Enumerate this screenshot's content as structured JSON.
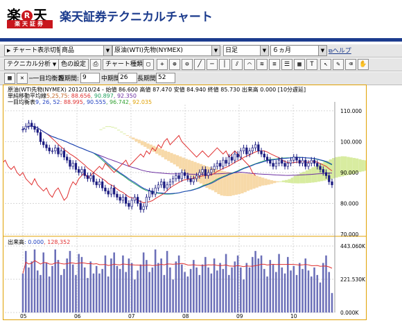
{
  "header": {
    "logo_text": [
      "楽",
      "R",
      "天"
    ],
    "logo_sub": "楽天証券",
    "title": "楽天証券テクニカルチャート"
  },
  "toolbar1": {
    "chart_switch": "チャート表示切替",
    "category": "商品",
    "instrument": "原油(WTI)先物(NYMEX)",
    "interval": "日足",
    "period": "６ヵ月",
    "help": "ヘルプ"
  },
  "toolbar2": {
    "tech_analysis": "テクニカル分析",
    "color_settings": "色の設定",
    "chart_type": "チャート種類",
    "tool_icons": [
      "crosshair-icon",
      "zoom-in-icon",
      "zoom-out-icon",
      "trendline-icon",
      "horizontal-line-icon",
      "vertical-line-icon",
      "parallel-line-icon",
      "arc-icon",
      "fan-icon",
      "retracement-icon",
      "cycle-icon",
      "grid-icon",
      "text-tool-icon",
      "pointer-icon",
      "delete-icon",
      "erase-icon",
      "hand-icon"
    ]
  },
  "toolbar3": {
    "indicator": "一目均衡表",
    "short_label": "短期間:",
    "short_value": "9",
    "mid_label": "中期間:",
    "mid_value": "26",
    "long_label": "長期間:",
    "long_value": "52"
  },
  "info": {
    "line1": "原油(WTI先物(NYMEX) 2012/10/24 - 始値 86.600 高値 87.470 安値 84.940 終値 85.730 出来高 0.000 [10分遅延]",
    "line2_prefix": "単純移動平均線",
    "line2_params": "5,25,75",
    "line2_values": [
      ": 88.656",
      ", 90.897",
      ", 92.350"
    ],
    "line3_prefix": "一目均衡表",
    "line3_params": "9, 26, 52",
    "line3_values": [
      ": 88.995",
      ", 90.555",
      ", 96.742",
      ", 92.035"
    ],
    "volume_label": "出来高",
    "volume_values": [
      ": 0.000",
      ", 128,352"
    ]
  },
  "colors": {
    "brand": "#c8161d",
    "title": "#1a3a8c",
    "frame": "#e0a000",
    "cloud_bear": "#f7d9a8",
    "cloud_bull": "#d8eca0",
    "sma5": "#e03030",
    "sma25": "#20a060",
    "sma75": "#6a2ca0",
    "volume_bar": "#6b6fb8"
  },
  "chart_data": {
    "type": "candlestick",
    "y_ticks": [
      "110.000",
      "100.000",
      "90.000",
      "80.000",
      "70.000"
    ],
    "ylim": [
      70,
      112
    ],
    "volume_ticks": [
      "443.060K",
      "221.530K",
      "0.000K"
    ],
    "x_ticks": [
      "05",
      "06",
      "07",
      "08",
      "09",
      "10"
    ],
    "x_year": "2012",
    "closes": [
      104,
      105,
      106,
      105,
      104,
      103,
      100,
      99,
      98,
      97,
      97,
      98,
      96,
      97,
      95,
      94,
      92,
      93,
      91,
      90,
      91,
      89,
      88,
      89,
      87,
      86,
      87,
      85,
      84,
      83,
      85,
      83,
      82,
      81,
      82,
      80,
      79,
      81,
      82,
      80,
      78,
      79,
      82,
      84,
      83,
      85,
      86,
      87,
      85,
      86,
      87,
      88,
      89,
      88,
      90,
      89,
      88,
      87,
      88,
      89,
      90,
      91,
      89,
      90,
      91,
      92,
      93,
      92,
      94,
      93,
      95,
      94,
      96,
      95,
      97,
      98,
      96,
      97,
      98,
      99,
      97,
      96,
      95,
      94,
      93,
      92,
      93,
      94,
      93,
      92,
      93,
      94,
      95,
      94,
      93,
      94,
      92,
      93,
      94,
      93,
      92,
      91,
      90,
      89,
      87,
      86
    ],
    "volumes": [
      260,
      410,
      300,
      340,
      420,
      280,
      250,
      400,
      330,
      240,
      310,
      420,
      350,
      250,
      290,
      360,
      410,
      320,
      250,
      390,
      370,
      300,
      230,
      340,
      260,
      310,
      260,
      290,
      380,
      240,
      360,
      400,
      310,
      290,
      380,
      270,
      360,
      330,
      220,
      280,
      320,
      400,
      350,
      270,
      300,
      420,
      330,
      360,
      250,
      410,
      300,
      220,
      340,
      380,
      320,
      270,
      240,
      290,
      350,
      300,
      250,
      320,
      370,
      300,
      260,
      360,
      280,
      330,
      290,
      390,
      250,
      300,
      340,
      380,
      300,
      220,
      330,
      300,
      370,
      410,
      360,
      380,
      290,
      240,
      350,
      320,
      270,
      390,
      300,
      260,
      370,
      280,
      310,
      250,
      330,
      290,
      360,
      280,
      240,
      300,
      250,
      200,
      330,
      380,
      270,
      130
    ]
  }
}
